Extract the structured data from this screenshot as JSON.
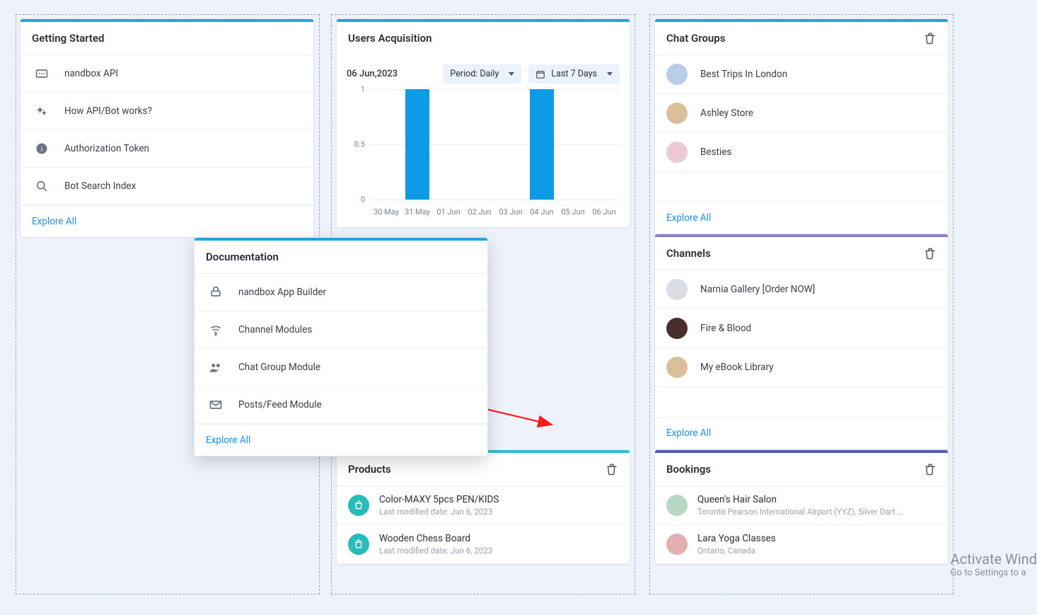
{
  "getting_started": {
    "title": "Getting Started",
    "items": [
      {
        "label": "nandbox API",
        "icon": "api"
      },
      {
        "label": "How API/Bot works?",
        "icon": "gears"
      },
      {
        "label": "Authorization Token",
        "icon": "info"
      },
      {
        "label": "Bot Search Index",
        "icon": "search"
      }
    ],
    "footer": "Explore All"
  },
  "users_acquisition": {
    "title": "Users Acquisition",
    "date_label": "06 Jun,2023",
    "period_label": "Period: Daily",
    "range_label": "Last 7 Days"
  },
  "chart_data": {
    "type": "bar",
    "title": "Users Acquisition",
    "categories": [
      "30 May",
      "31 May",
      "01 Jun",
      "02 Jun",
      "03 Jun",
      "04 Jun",
      "05 Jun",
      "06 Jun"
    ],
    "values": [
      0,
      1,
      0,
      0,
      0,
      1,
      0,
      0
    ],
    "xlabel": "",
    "ylabel": "",
    "ylim": [
      0,
      1
    ],
    "y_ticks": [
      0,
      0.5,
      1.0
    ]
  },
  "documentation": {
    "title": "Documentation",
    "items": [
      {
        "label": "nandbox App Builder",
        "icon": "builder"
      },
      {
        "label": "Channel Modules",
        "icon": "wifi"
      },
      {
        "label": "Chat Group Module",
        "icon": "people"
      },
      {
        "label": "Posts/Feed Module",
        "icon": "mail"
      }
    ],
    "footer": "Explore All"
  },
  "chat_groups": {
    "title": "Chat Groups",
    "items": [
      {
        "label": "Best Trips In London"
      },
      {
        "label": "Ashley Store"
      },
      {
        "label": "Besties"
      }
    ],
    "footer": "Explore All"
  },
  "channels": {
    "title": "Channels",
    "items": [
      {
        "label": "Narnia Gallery [Order NOW]"
      },
      {
        "label": "Fire & Blood"
      },
      {
        "label": "My eBook Library"
      }
    ],
    "footer": "Explore All"
  },
  "products": {
    "title": "Products",
    "items": [
      {
        "label": "Color-MAXY 5pcs PEN/KIDS",
        "sub": "Last modified date: Jun 6, 2023"
      },
      {
        "label": "Wooden Chess Board",
        "sub": "Last modified date: Jun 6, 2023"
      }
    ]
  },
  "bookings": {
    "title": "Bookings",
    "items": [
      {
        "label": "Queen's Hair Salon",
        "sub": "Toronto Pearson International Airport (YYZ), Silver Dart ..."
      },
      {
        "label": "Lara Yoga Classes",
        "sub": "Ontario, Canada"
      }
    ]
  },
  "watermark": {
    "line1": "Activate Wind",
    "line2": "Go to Settings to a"
  }
}
